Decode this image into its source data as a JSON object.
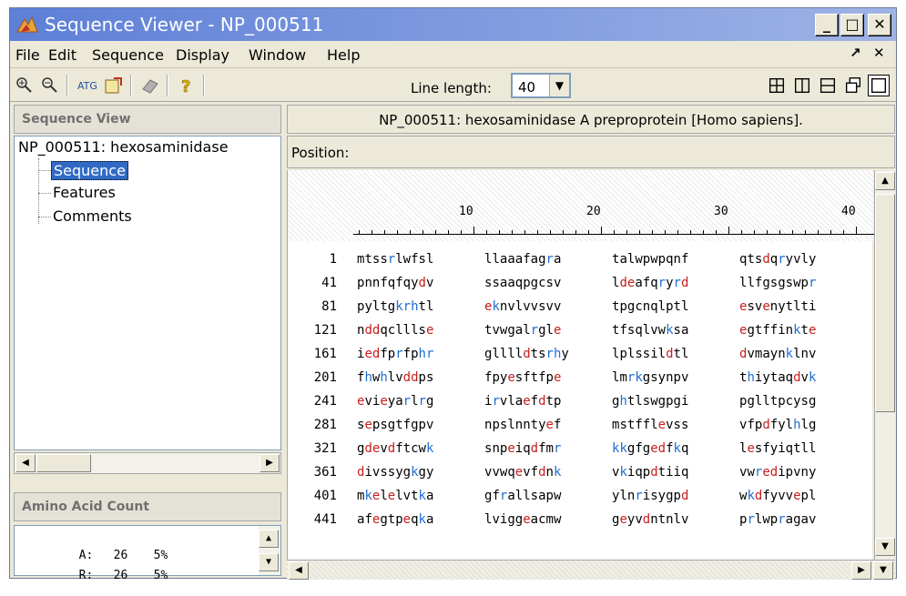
{
  "window": {
    "title": "Sequence Viewer - NP_000511",
    "minimize_label": "_",
    "maximize_label": "□",
    "close_label": "✕"
  },
  "menu": {
    "items": [
      "File",
      "Edit",
      "Sequence",
      "Display",
      "Window",
      "Help"
    ],
    "right_controls": [
      "↗",
      "✕"
    ]
  },
  "toolbar": {
    "line_length_label": "Line length:",
    "line_length_value": "40",
    "icons": [
      "zoom-in-icon",
      "zoom-out-icon",
      "swap-icon",
      "export-icon",
      "eraser-icon",
      "help-icon"
    ],
    "layout_icons": [
      "grid-layout-icon",
      "vertical-split-icon",
      "horizontal-split-icon",
      "cascade-icon",
      "single-view-icon"
    ]
  },
  "left": {
    "header": "Sequence View",
    "tree_root": "NP_000511: hexosaminidase",
    "tree_children": [
      "Sequence",
      "Features",
      "Comments"
    ],
    "selected_child": "Sequence",
    "count_header": "Amino Acid Count",
    "counts": [
      {
        "aa": "A:",
        "n": "26",
        "pct": "5%"
      },
      {
        "aa": "R:",
        "n": "26",
        "pct": "5%"
      }
    ]
  },
  "right": {
    "title": "NP_000511: hexosaminidase A preproprotein [Homo sapiens].",
    "position_label": "Position:",
    "ruler_labels": [
      "10",
      "20",
      "30",
      "40"
    ],
    "rows": [
      {
        "num": "1",
        "blocks": [
          "mtssrlwfsl",
          "llaaafagra",
          "talwpwpqnf",
          "qtsdqryvly"
        ]
      },
      {
        "num": "41",
        "blocks": [
          "pnnfqfqydv",
          "ssaaqpgcsv",
          "ldeafqryrd",
          "llfgsgswpr"
        ]
      },
      {
        "num": "81",
        "blocks": [
          "pyltgkrhtl",
          "eknvlvvsvv",
          "tpgcnqlptl",
          "esvenytlti"
        ]
      },
      {
        "num": "121",
        "blocks": [
          "nddqclllse",
          "tvwgalrgle",
          "tfsqlvwksa",
          "egtffinkte"
        ]
      },
      {
        "num": "161",
        "blocks": [
          "iedfprfphr",
          "glllldtsrhy",
          "lplssildtl",
          "dvmaynklnv"
        ]
      },
      {
        "num": "201",
        "blocks": [
          "fhwhlvddps",
          "fpyesftfpe",
          "lmrkgsynpv",
          "thiytaqdvk"
        ]
      },
      {
        "num": "241",
        "blocks": [
          "evieyarlrg",
          "irvlaefdtp",
          "ghtlswgpgi",
          "pglltpcysg"
        ]
      },
      {
        "num": "281",
        "blocks": [
          "sepsgtfgpv",
          "npslnntyef",
          "mstfflevss",
          "vfpdfylhlg"
        ]
      },
      {
        "num": "321",
        "blocks": [
          "gdevdftcwk",
          "snpeiqdfmr",
          "kkgfgedfkq",
          "lesfyiqtll"
        ]
      },
      {
        "num": "361",
        "blocks": [
          "divssygkgy",
          "vvwqevfdnk",
          "vkiqpdtiiq",
          "vwredipvny"
        ]
      },
      {
        "num": "401",
        "blocks": [
          "mkelelvtka",
          "gfrallsapw",
          "ylnrisygpd",
          "wkdfyvvepl"
        ]
      },
      {
        "num": "441",
        "blocks": [
          "afegtpeqka",
          "lviggeacmw",
          "geyvdntnlv",
          "prlwpragav"
        ]
      }
    ]
  },
  "colors": {
    "acidic": "#c81e1e",
    "basic": "#1e6ed2",
    "selection": "#316ac5"
  }
}
